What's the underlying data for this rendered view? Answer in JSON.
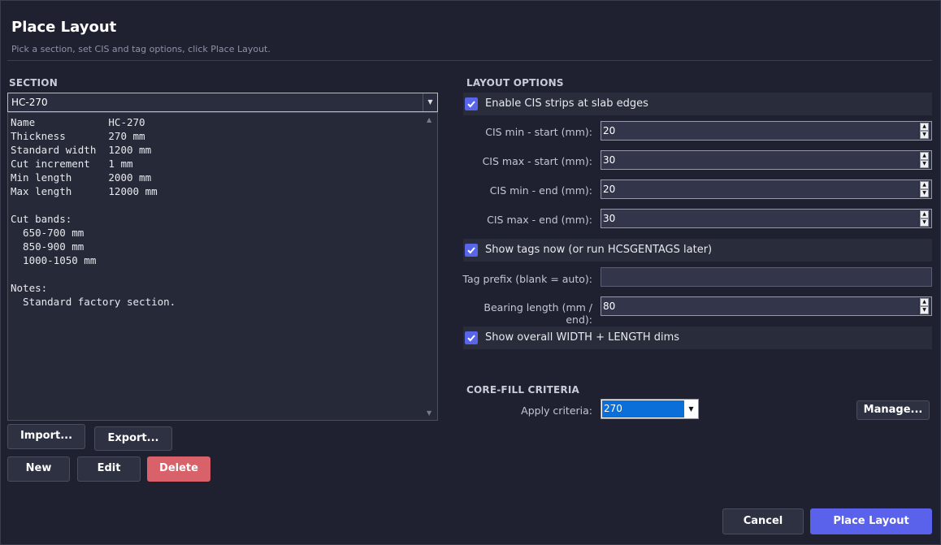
{
  "header": {
    "title": "Place Layout",
    "subtitle": "Pick a section, set CIS and tag options, click Place Layout."
  },
  "section": {
    "heading": "SECTION",
    "selected": "HC-270",
    "details": "Name            HC-270\nThickness       270 mm\nStandard width  1200 mm\nCut increment   1 mm\nMin length      2000 mm\nMax length      12000 mm\n\nCut bands:\n  650-700 mm\n  850-900 mm\n  1000-1050 mm\n\nNotes:\n  Standard factory section.",
    "buttons": {
      "import": "Import...",
      "export": "Export...",
      "new": "New",
      "edit": "Edit",
      "delete": "Delete"
    }
  },
  "layout_options": {
    "heading": "LAYOUT OPTIONS",
    "enable_cis": {
      "label": "Enable CIS strips at slab edges",
      "checked": true
    },
    "cis_min_start": {
      "label": "CIS min - start (mm):",
      "value": "20"
    },
    "cis_max_start": {
      "label": "CIS max - start (mm):",
      "value": "30"
    },
    "cis_min_end": {
      "label": "CIS min - end (mm):",
      "value": "20"
    },
    "cis_max_end": {
      "label": "CIS max - end (mm):",
      "value": "30"
    },
    "show_tags": {
      "label": "Show tags now (or run HCSGENTAGS later)",
      "checked": true
    },
    "tag_prefix": {
      "label": "Tag prefix (blank = auto):",
      "value": ""
    },
    "bearing_length": {
      "label": "Bearing length (mm / end):",
      "value": "80"
    },
    "show_dims": {
      "label": "Show overall WIDTH + LENGTH dims",
      "checked": true
    }
  },
  "core_fill": {
    "heading": "CORE-FILL CRITERIA",
    "apply_label": "Apply criteria:",
    "apply_value": "270",
    "manage": "Manage..."
  },
  "footer": {
    "cancel": "Cancel",
    "place": "Place Layout"
  },
  "colors": {
    "background": "#1f2130",
    "accent": "#5a62ec",
    "checkbox": "#5865e8",
    "danger": "#d9616a",
    "selection": "#0a6fd8"
  }
}
